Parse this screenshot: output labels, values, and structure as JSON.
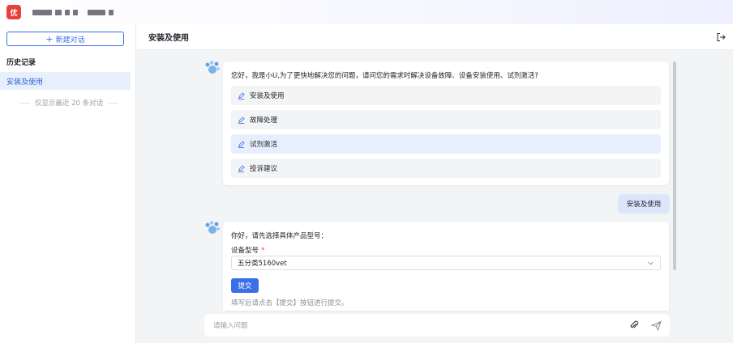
{
  "app": {
    "logo_text": "优"
  },
  "sidebar": {
    "new_chat_label": "新建对话",
    "history_title": "历史记录",
    "items": [
      {
        "label": "安装及使用"
      }
    ],
    "note": "仅显示最近 20 条对话"
  },
  "main": {
    "title": "安装及使用"
  },
  "messages": {
    "bot_greeting": "您好，我是小U,为了更快地解决您的问题，请问您的需求时解决设备故障、设备安装使用、试剂激活?",
    "options": [
      {
        "label": "安装及使用"
      },
      {
        "label": "故障处理"
      },
      {
        "label": "试剂激活"
      },
      {
        "label": "投诉建议"
      }
    ],
    "user_reply": "安装及使用",
    "bot_form_prompt": "你好，请先选择具体产品型号：",
    "form_label": "设备型号",
    "required_mark": "*",
    "select_value": "五分类5160vet",
    "submit_label": "提交",
    "hint": "填写后请点击【提交】按钮进行提交。"
  },
  "input": {
    "placeholder": "请输入问题"
  },
  "colors": {
    "accent": "#3b6fe8",
    "logo": "#e8403b",
    "selected_bg": "#e8effc",
    "user_bubble": "#dbe6fb"
  },
  "icons": [
    "plus-icon",
    "exit-icon",
    "bot-avatar-icon",
    "pen-icon",
    "chevron-down-icon",
    "paperclip-icon",
    "send-icon"
  ]
}
